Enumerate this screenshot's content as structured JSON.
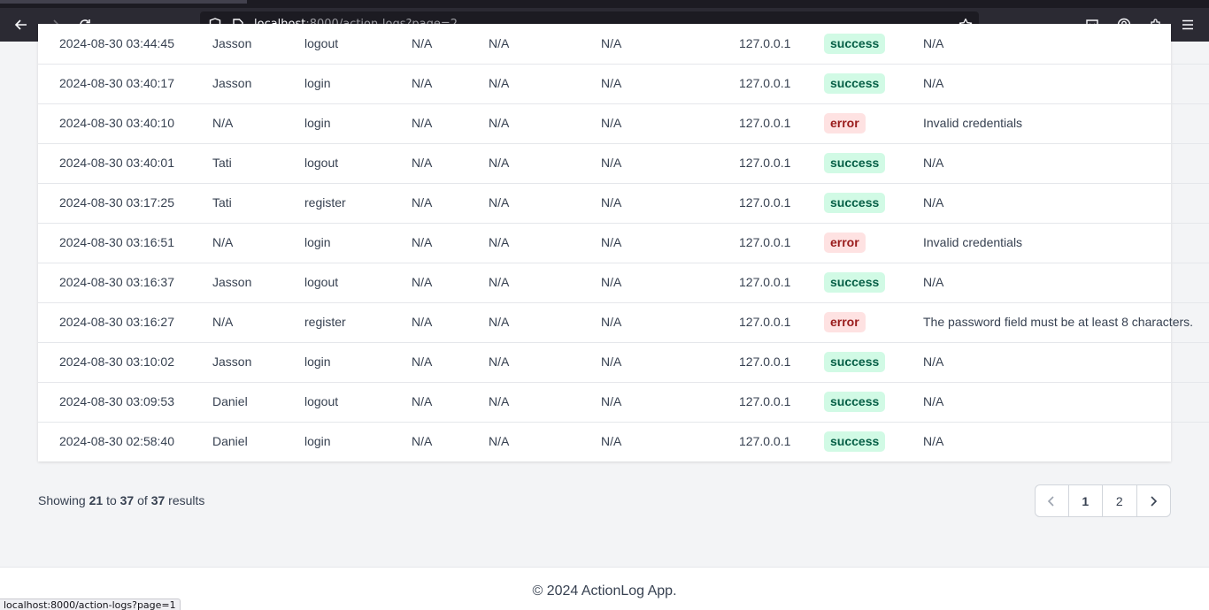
{
  "browser": {
    "url_host": "localhost",
    "url_rest": ":8000/action-logs?page=2",
    "icons": {
      "back": "arrow-left-icon",
      "forward": "arrow-right-icon",
      "reload": "reload-icon",
      "shield": "shield-icon",
      "page": "page-icon",
      "star": "star-icon",
      "pocket": "pocket-icon",
      "account": "account-icon",
      "extensions": "extensions-icon",
      "menu": "menu-icon"
    },
    "status_link": "localhost:8000/action-logs?page=1"
  },
  "colors": {
    "success_bg": "#d1fae5",
    "success_text": "#065f46",
    "error_bg": "#fee2e2",
    "error_text": "#991b1b"
  },
  "logs": [
    {
      "date": "2024-08-30 03:44:45",
      "user": "Jasson",
      "action": "logout",
      "a": "N/A",
      "b": "N/A",
      "c": "N/A",
      "ip": "127.0.0.1",
      "status": "success",
      "message": "N/A"
    },
    {
      "date": "2024-08-30 03:40:17",
      "user": "Jasson",
      "action": "login",
      "a": "N/A",
      "b": "N/A",
      "c": "N/A",
      "ip": "127.0.0.1",
      "status": "success",
      "message": "N/A"
    },
    {
      "date": "2024-08-30 03:40:10",
      "user": "N/A",
      "action": "login",
      "a": "N/A",
      "b": "N/A",
      "c": "N/A",
      "ip": "127.0.0.1",
      "status": "error",
      "message": "Invalid credentials"
    },
    {
      "date": "2024-08-30 03:40:01",
      "user": "Tati",
      "action": "logout",
      "a": "N/A",
      "b": "N/A",
      "c": "N/A",
      "ip": "127.0.0.1",
      "status": "success",
      "message": "N/A"
    },
    {
      "date": "2024-08-30 03:17:25",
      "user": "Tati",
      "action": "register",
      "a": "N/A",
      "b": "N/A",
      "c": "N/A",
      "ip": "127.0.0.1",
      "status": "success",
      "message": "N/A"
    },
    {
      "date": "2024-08-30 03:16:51",
      "user": "N/A",
      "action": "login",
      "a": "N/A",
      "b": "N/A",
      "c": "N/A",
      "ip": "127.0.0.1",
      "status": "error",
      "message": "Invalid credentials"
    },
    {
      "date": "2024-08-30 03:16:37",
      "user": "Jasson",
      "action": "logout",
      "a": "N/A",
      "b": "N/A",
      "c": "N/A",
      "ip": "127.0.0.1",
      "status": "success",
      "message": "N/A"
    },
    {
      "date": "2024-08-30 03:16:27",
      "user": "N/A",
      "action": "register",
      "a": "N/A",
      "b": "N/A",
      "c": "N/A",
      "ip": "127.0.0.1",
      "status": "error",
      "message": "The password field must be at least 8 characters."
    },
    {
      "date": "2024-08-30 03:10:02",
      "user": "Jasson",
      "action": "login",
      "a": "N/A",
      "b": "N/A",
      "c": "N/A",
      "ip": "127.0.0.1",
      "status": "success",
      "message": "N/A"
    },
    {
      "date": "2024-08-30 03:09:53",
      "user": "Daniel",
      "action": "logout",
      "a": "N/A",
      "b": "N/A",
      "c": "N/A",
      "ip": "127.0.0.1",
      "status": "success",
      "message": "N/A"
    },
    {
      "date": "2024-08-30 02:58:40",
      "user": "Daniel",
      "action": "login",
      "a": "N/A",
      "b": "N/A",
      "c": "N/A",
      "ip": "127.0.0.1",
      "status": "success",
      "message": "N/A"
    }
  ],
  "pagination": {
    "showing_label": "Showing",
    "from": "21",
    "to_label": "to",
    "to": "37",
    "of_label": "of",
    "total": "37",
    "results_label": "results",
    "pages": [
      "1",
      "2"
    ],
    "prev_icon": "chevron-left-icon",
    "next_icon": "chevron-right-icon"
  },
  "footer": {
    "copyright": "© 2024 ActionLog App."
  }
}
